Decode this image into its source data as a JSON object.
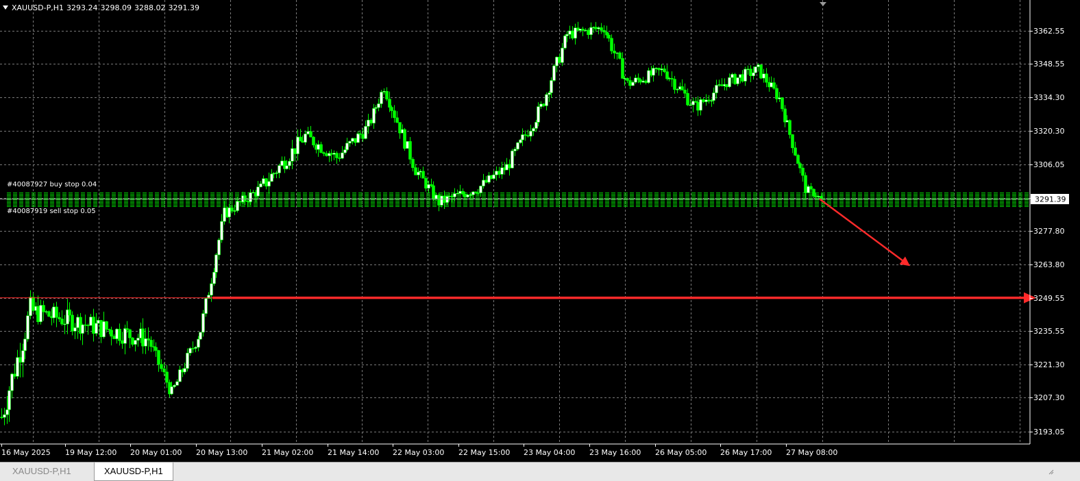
{
  "header": {
    "symbol_label": "XAUUSD-P,H1",
    "open": "3293.24",
    "high": "3298.09",
    "low": "3288.02",
    "close": "3291.39"
  },
  "tabs": [
    {
      "label": "XAUUSD-P,H1",
      "active": false
    },
    {
      "label": "XAUUSD-P,H1",
      "active": true
    }
  ],
  "colors": {
    "background": "#000000",
    "grid": "#7a7a7a",
    "bull_candle": "#ffffff",
    "bear_candle": "#00ff00",
    "wick": "#00ff00",
    "order_lines": "#00c800",
    "current_price_line": "#9a9a9a",
    "target_line": "#ff2a2a",
    "arrow": "#ff2a2a",
    "axis_text": "#ffffff"
  },
  "chart_data": {
    "type": "candlestick",
    "symbol": "XAUUSD-P",
    "timeframe": "H1",
    "y_ticks": [
      3362.55,
      3348.55,
      3334.3,
      3320.3,
      3306.05,
      3291.8,
      3277.8,
      3263.8,
      3249.55,
      3235.55,
      3221.3,
      3207.3,
      3193.05
    ],
    "y_tick_labels": [
      "3362.55",
      "3348.55",
      "3334.30",
      "3320.30",
      "3306.05",
      "3277.80",
      "3263.80",
      "3249.55",
      "3235.55",
      "3221.30",
      "3207.30",
      "3193.05"
    ],
    "ylim": [
      3187.5,
      3374.0
    ],
    "x_labels": [
      "16 May 2025",
      "19 May 12:00",
      "20 May 01:00",
      "20 May 13:00",
      "21 May 02:00",
      "21 May 14:00",
      "22 May 03:00",
      "22 May 15:00",
      "23 May 04:00",
      "23 May 16:00",
      "26 May 05:00",
      "26 May 17:00",
      "27 May 08:00"
    ],
    "current_price": 3291.39,
    "current_price_label": "3291.39",
    "target_level": 3249.55,
    "order_labels": [
      "#40087927 buy stop 0.04",
      "#40087919 sell stop 0.05"
    ],
    "pending_order_levels": [
      3294.2,
      3293.6,
      3293.0,
      3292.4,
      3291.8,
      3291.2,
      3290.6,
      3290.0,
      3289.4,
      3288.8,
      3288.2
    ],
    "arrow": {
      "from": 3291.4,
      "to": 3263.0
    },
    "trend_segments": [
      {
        "bars": 12,
        "from": 3195.0,
        "to": 3244.0,
        "wave": 6.0
      },
      {
        "bars": 45,
        "from": 3244.0,
        "to": 3232.0,
        "wave": 4.5
      },
      {
        "bars": 9,
        "from": 3232.0,
        "to": 3209.0,
        "wave": 3.0
      },
      {
        "bars": 11,
        "from": 3209.0,
        "to": 3236.0,
        "wave": 3.0
      },
      {
        "bars": 9,
        "from": 3236.0,
        "to": 3285.0,
        "wave": 3.0
      },
      {
        "bars": 14,
        "from": 3285.0,
        "to": 3296.0,
        "wave": 2.5
      },
      {
        "bars": 17,
        "from": 3296.0,
        "to": 3318.0,
        "wave": 3.5
      },
      {
        "bars": 12,
        "from": 3318.0,
        "to": 3309.0,
        "wave": 3.0
      },
      {
        "bars": 12,
        "from": 3309.0,
        "to": 3322.0,
        "wave": 3.0
      },
      {
        "bars": 6,
        "from": 3322.0,
        "to": 3339.0,
        "wave": 2.5
      },
      {
        "bars": 12,
        "from": 3339.0,
        "to": 3304.0,
        "wave": 3.0
      },
      {
        "bars": 9,
        "from": 3304.0,
        "to": 3290.0,
        "wave": 2.5
      },
      {
        "bars": 15,
        "from": 3290.0,
        "to": 3296.0,
        "wave": 2.5
      },
      {
        "bars": 11,
        "from": 3296.0,
        "to": 3305.0,
        "wave": 2.5
      },
      {
        "bars": 13,
        "from": 3305.0,
        "to": 3330.0,
        "wave": 3.0
      },
      {
        "bars": 10,
        "from": 3330.0,
        "to": 3361.0,
        "wave": 3.0
      },
      {
        "bars": 14,
        "from": 3361.0,
        "to": 3364.0,
        "wave": 2.5
      },
      {
        "bars": 9,
        "from": 3364.0,
        "to": 3340.0,
        "wave": 3.0
      },
      {
        "bars": 14,
        "from": 3340.0,
        "to": 3346.0,
        "wave": 2.5
      },
      {
        "bars": 12,
        "from": 3346.0,
        "to": 3330.0,
        "wave": 3.0
      },
      {
        "bars": 12,
        "from": 3330.0,
        "to": 3341.0,
        "wave": 2.5
      },
      {
        "bars": 12,
        "from": 3341.0,
        "to": 3346.0,
        "wave": 2.5
      },
      {
        "bars": 8,
        "from": 3346.0,
        "to": 3334.0,
        "wave": 2.5
      },
      {
        "bars": 10,
        "from": 3334.0,
        "to": 3296.0,
        "wave": 2.5
      },
      {
        "bars": 6,
        "from": 3296.0,
        "to": 3291.4,
        "wave": 1.5
      }
    ]
  }
}
